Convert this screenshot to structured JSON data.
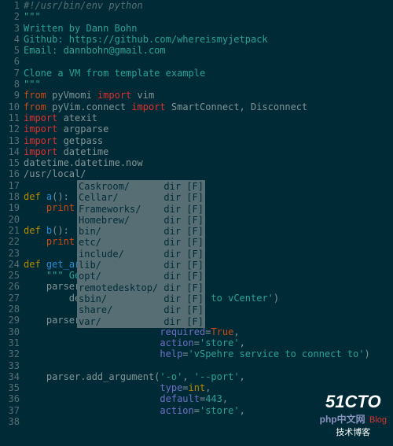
{
  "gutter_start": 1,
  "gutter_end": 38,
  "arrow_markers": [
    16,
    18,
    21,
    24
  ],
  "tilde_markers": [
    25
  ],
  "code_lines": [
    {
      "n": 1,
      "tokens": [
        {
          "c": "c-comment",
          "t": "#!/usr/bin/env python"
        }
      ]
    },
    {
      "n": 2,
      "tokens": [
        {
          "c": "c-string",
          "t": "\"\"\""
        }
      ]
    },
    {
      "n": 3,
      "tokens": [
        {
          "c": "c-string",
          "t": "Written by Dann Bohn"
        }
      ]
    },
    {
      "n": 4,
      "tokens": [
        {
          "c": "c-string",
          "t": "Github: https://github.com/whereismyjetpack"
        }
      ]
    },
    {
      "n": 5,
      "tokens": [
        {
          "c": "c-string",
          "t": "Email: dannbohn@gmail.com"
        }
      ]
    },
    {
      "n": 6,
      "tokens": []
    },
    {
      "n": 7,
      "tokens": [
        {
          "c": "c-string",
          "t": "Clone a VM from template example"
        }
      ]
    },
    {
      "n": 8,
      "tokens": [
        {
          "c": "c-string",
          "t": "\"\"\""
        }
      ]
    },
    {
      "n": 9,
      "tokens": [
        {
          "c": "c-keyword",
          "t": "from"
        },
        {
          "t": " pyVmomi "
        },
        {
          "c": "c-import",
          "t": "import"
        },
        {
          "t": " vim"
        }
      ]
    },
    {
      "n": 10,
      "tokens": [
        {
          "c": "c-keyword",
          "t": "from"
        },
        {
          "t": " pyVim.connect "
        },
        {
          "c": "c-import",
          "t": "import"
        },
        {
          "t": " SmartConnect, Disconnect"
        }
      ]
    },
    {
      "n": 11,
      "tokens": [
        {
          "c": "c-import",
          "t": "import"
        },
        {
          "t": " atexit"
        }
      ]
    },
    {
      "n": 12,
      "tokens": [
        {
          "c": "c-import",
          "t": "import"
        },
        {
          "t": " argparse"
        }
      ]
    },
    {
      "n": 13,
      "tokens": [
        {
          "c": "c-import",
          "t": "import"
        },
        {
          "t": " getpass"
        }
      ]
    },
    {
      "n": 14,
      "tokens": [
        {
          "c": "c-import",
          "t": "import"
        },
        {
          "t": " datetime"
        }
      ]
    },
    {
      "n": 15,
      "tokens": [
        {
          "t": "datetime.datetime.now"
        }
      ]
    },
    {
      "n": 16,
      "tokens": [
        {
          "c": "c-path",
          "t": "/usr/local/"
        }
      ]
    },
    {
      "n": 17,
      "tokens": []
    },
    {
      "n": 18,
      "tokens": [
        {
          "c": "c-def",
          "t": "def"
        },
        {
          "t": " "
        },
        {
          "c": "c-func",
          "t": "a"
        },
        {
          "t": "():"
        }
      ]
    },
    {
      "n": 19,
      "tokens": [
        {
          "t": "    "
        },
        {
          "c": "c-keyword",
          "t": "print"
        }
      ]
    },
    {
      "n": 20,
      "tokens": []
    },
    {
      "n": 21,
      "tokens": [
        {
          "c": "c-def",
          "t": "def"
        },
        {
          "t": " "
        },
        {
          "c": "c-func",
          "t": "b"
        },
        {
          "t": "():"
        }
      ]
    },
    {
      "n": 22,
      "tokens": [
        {
          "t": "    "
        },
        {
          "c": "c-keyword",
          "t": "print"
        }
      ]
    },
    {
      "n": 23,
      "tokens": []
    },
    {
      "n": 24,
      "tokens": [
        {
          "c": "c-def",
          "t": "def"
        },
        {
          "t": " "
        },
        {
          "c": "c-func",
          "t": "get_ar"
        }
      ]
    },
    {
      "n": 25,
      "tokens": [
        {
          "t": "    "
        },
        {
          "c": "c-string",
          "t": "\"\"\" Ge"
        }
      ]
    },
    {
      "n": 26,
      "tokens": [
        {
          "t": "    parser"
        },
        {
          "t": "               r("
        }
      ]
    },
    {
      "n": 27,
      "tokens": [
        {
          "t": "        de"
        },
        {
          "t": "               "
        },
        {
          "c": "c-string",
          "t": "talking to vCenter'"
        },
        {
          "t": ")"
        }
      ]
    },
    {
      "n": 28,
      "tokens": []
    },
    {
      "n": 29,
      "tokens": [
        {
          "t": "    parser"
        },
        {
          "t": "               "
        },
        {
          "c": "c-string",
          "t": "st'"
        },
        {
          "t": ","
        }
      ]
    },
    {
      "n": 30,
      "tokens": [
        {
          "t": "                        "
        },
        {
          "c": "c-arg",
          "t": "required"
        },
        {
          "t": "="
        },
        {
          "c": "c-bool",
          "t": "True"
        },
        {
          "t": ","
        }
      ]
    },
    {
      "n": 31,
      "tokens": [
        {
          "t": "                        "
        },
        {
          "c": "c-arg",
          "t": "action"
        },
        {
          "t": "="
        },
        {
          "c": "c-string",
          "t": "'store'"
        },
        {
          "t": ","
        }
      ]
    },
    {
      "n": 32,
      "tokens": [
        {
          "t": "                        "
        },
        {
          "c": "c-arg",
          "t": "help"
        },
        {
          "t": "="
        },
        {
          "c": "c-string",
          "t": "'vSpehre service to connect to'"
        },
        {
          "t": ")"
        }
      ]
    },
    {
      "n": 33,
      "tokens": []
    },
    {
      "n": 34,
      "tokens": [
        {
          "t": "    parser.add_argument("
        },
        {
          "c": "c-string",
          "t": "'-o'"
        },
        {
          "t": ", "
        },
        {
          "c": "c-string",
          "t": "'--port'"
        },
        {
          "t": ","
        }
      ]
    },
    {
      "n": 35,
      "tokens": [
        {
          "t": "                        "
        },
        {
          "c": "c-arg",
          "t": "type"
        },
        {
          "t": "="
        },
        {
          "c": "c-type",
          "t": "int"
        },
        {
          "t": ","
        }
      ]
    },
    {
      "n": 36,
      "tokens": [
        {
          "t": "                        "
        },
        {
          "c": "c-arg",
          "t": "default"
        },
        {
          "t": "="
        },
        {
          "c": "c-number",
          "t": "443"
        },
        {
          "t": ","
        }
      ]
    },
    {
      "n": 37,
      "tokens": [
        {
          "t": "                        "
        },
        {
          "c": "c-arg",
          "t": "action"
        },
        {
          "t": "="
        },
        {
          "c": "c-string",
          "t": "'store'"
        },
        {
          "t": ","
        }
      ]
    },
    {
      "n": 38,
      "tokens": []
    }
  ],
  "popup": {
    "items": [
      {
        "name": "Caskroom/",
        "kind": "dir",
        "flag": "[F]"
      },
      {
        "name": "Cellar/",
        "kind": "dir",
        "flag": "[F]"
      },
      {
        "name": "Frameworks/",
        "kind": "dir",
        "flag": "[F]"
      },
      {
        "name": "Homebrew/",
        "kind": "dir",
        "flag": "[F]"
      },
      {
        "name": "bin/",
        "kind": "dir",
        "flag": "[F]"
      },
      {
        "name": "etc/",
        "kind": "dir",
        "flag": "[F]"
      },
      {
        "name": "include/",
        "kind": "dir",
        "flag": "[F]"
      },
      {
        "name": "lib/",
        "kind": "dir",
        "flag": "[F]"
      },
      {
        "name": "opt/",
        "kind": "dir",
        "flag": "[F]"
      },
      {
        "name": "remotedesktop/",
        "kind": "dir",
        "flag": "[F]"
      },
      {
        "name": "sbin/",
        "kind": "dir",
        "flag": "[F]"
      },
      {
        "name": "share/",
        "kind": "dir",
        "flag": "[F]"
      },
      {
        "name": "var/",
        "kind": "dir",
        "flag": "[F]"
      }
    ]
  },
  "watermark": {
    "big": "51CTO",
    "sub": "技术博客",
    "badge": "php中文网",
    "blog": "Blog"
  }
}
